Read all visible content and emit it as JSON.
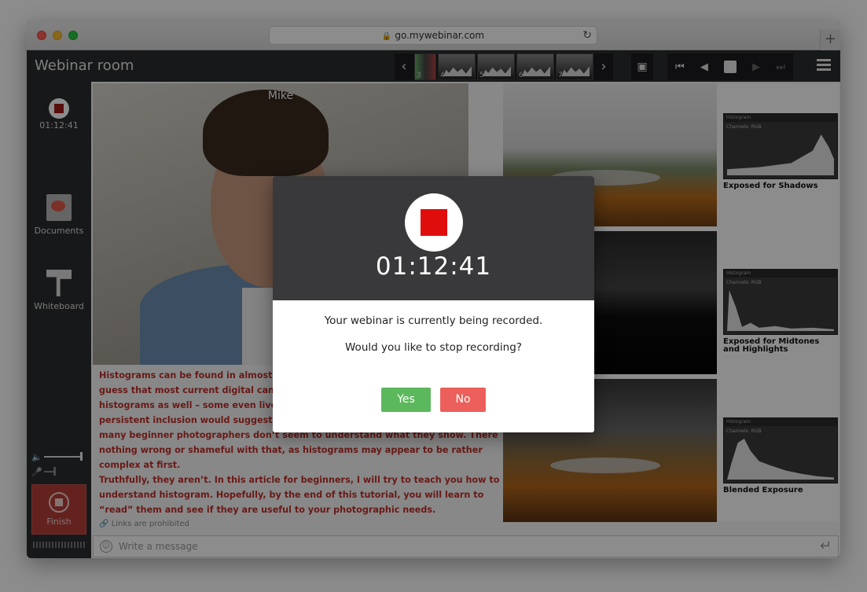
{
  "browser": {
    "url": "go.mywebinar.com",
    "new_tab_label": "+"
  },
  "header": {
    "title": "Webinar room",
    "thumbnails": [
      "3",
      "4",
      "5",
      "6",
      "7"
    ]
  },
  "sidebar": {
    "record_time": "01:12:41",
    "documents_label": "Documents",
    "whiteboard_label": "Whiteboard",
    "finish_label": "Finish"
  },
  "video": {
    "presenter_name": "Mike"
  },
  "chat": {
    "lines": [
      "Histograms can be found in almost any",
      "guess that most current digital cameras",
      "histograms as well – some even live as y",
      "persistent inclusion would suggest that",
      "many beginner photographers don’t seem to understand what they show. There is",
      "nothing wrong or shameful with that, as histograms may appear to be rather",
      "complex at first.",
      "Truthfully, they aren’t. In this article for beginners, I will try to teach you how to",
      "understand histogram. Hopefully, by the end of this tutorial, you will learn to",
      "“read” them and see if they are useful to your photographic needs."
    ],
    "links_notice": "Links are prohibited",
    "message_placeholder": "Write a message"
  },
  "slide": {
    "histogram_panel_title": "Histogram",
    "channel_label": "Channels:",
    "channel_value": "RGB",
    "captions": [
      "Exposed for Shadows",
      "Exposed for Midtones and Highlights",
      "Blended Exposure"
    ]
  },
  "dialog": {
    "time": "01:12:41",
    "message": "Your webinar is currently being recorded.",
    "question": "Would you like to stop recording?",
    "yes_label": "Yes",
    "no_label": "No"
  },
  "colors": {
    "yes_button": "#5cb85c",
    "no_button": "#ec5f5a",
    "record_red": "#e00d0d",
    "chat_text": "#c0302a"
  }
}
